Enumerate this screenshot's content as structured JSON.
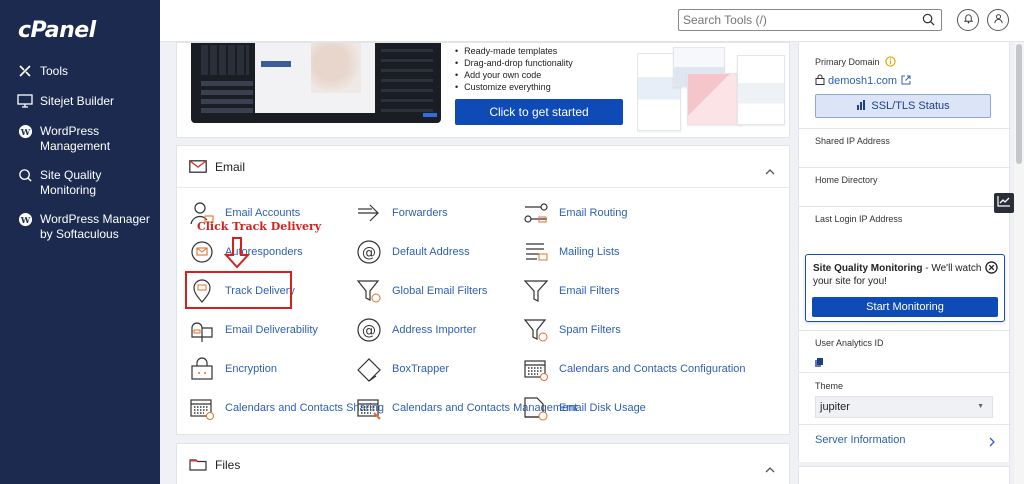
{
  "brand": {
    "logo": "cPanel"
  },
  "sidebar": {
    "items": [
      {
        "label": "Tools",
        "icon": "tools-icon"
      },
      {
        "label": "Sitejet Builder",
        "icon": "sitejet-icon"
      },
      {
        "label": "WordPress Management",
        "icon": "wordpress-icon"
      },
      {
        "label": "Site Quality Monitoring",
        "icon": "site-quality-icon"
      },
      {
        "label": "WordPress Manager by Softaculous",
        "icon": "wordpress-icon"
      }
    ]
  },
  "header": {
    "search_placeholder": "Search Tools (/)"
  },
  "banner": {
    "features": [
      "Ready-made templates",
      "Drag-and-drop functionality",
      "Add your own code",
      "Customize everything"
    ],
    "cta_label": "Click to get started"
  },
  "email": {
    "title": "Email",
    "tools": [
      {
        "label": "Email Accounts",
        "icon": "email-accounts-icon"
      },
      {
        "label": "Forwarders",
        "icon": "forwarders-icon"
      },
      {
        "label": "Email Routing",
        "icon": "email-routing-icon"
      },
      {
        "label": "Autoresponders",
        "icon": "autoresponders-icon"
      },
      {
        "label": "Default Address",
        "icon": "default-address-icon"
      },
      {
        "label": "Mailing Lists",
        "icon": "mailing-lists-icon"
      },
      {
        "label": "Track Delivery",
        "icon": "track-delivery-icon"
      },
      {
        "label": "Global Email Filters",
        "icon": "global-filters-icon"
      },
      {
        "label": "Email Filters",
        "icon": "email-filters-icon"
      },
      {
        "label": "Email Deliverability",
        "icon": "deliverability-icon"
      },
      {
        "label": "Address Importer",
        "icon": "address-importer-icon"
      },
      {
        "label": "Spam Filters",
        "icon": "spam-filters-icon"
      },
      {
        "label": "Encryption",
        "icon": "encryption-icon"
      },
      {
        "label": "BoxTrapper",
        "icon": "boxtrapper-icon"
      },
      {
        "label": "Calendars and Contacts Configuration",
        "icon": "calendar-config-icon"
      },
      {
        "label": "Calendars and Contacts Sharing",
        "icon": "calendar-sharing-icon"
      },
      {
        "label": "Calendars and Contacts Management",
        "icon": "calendar-management-icon"
      },
      {
        "label": "Email Disk Usage",
        "icon": "disk-usage-icon"
      }
    ]
  },
  "files": {
    "title": "Files"
  },
  "annotation": {
    "text": "Click Track Delivery",
    "color": "#d81f1f"
  },
  "stats": {
    "primary_domain_label": "Primary Domain",
    "primary_domain": "demosh1.com",
    "ssl_label": "SSL/TLS Status",
    "shared_ip_label": "Shared IP Address",
    "home_dir_label": "Home Directory",
    "last_login_label": "Last Login IP Address",
    "sqm_title": "Site Quality Monitoring",
    "sqm_text": " - We'll watch your site for you!",
    "sqm_button": "Start Monitoring",
    "analytics_label": "User Analytics ID",
    "theme_label": "Theme",
    "theme_value": "jupiter",
    "server_info_label": "Server Information"
  },
  "colors": {
    "sidebar": "#1b2a4e",
    "accent": "#0f4bb7",
    "link": "#2f5fb3"
  }
}
